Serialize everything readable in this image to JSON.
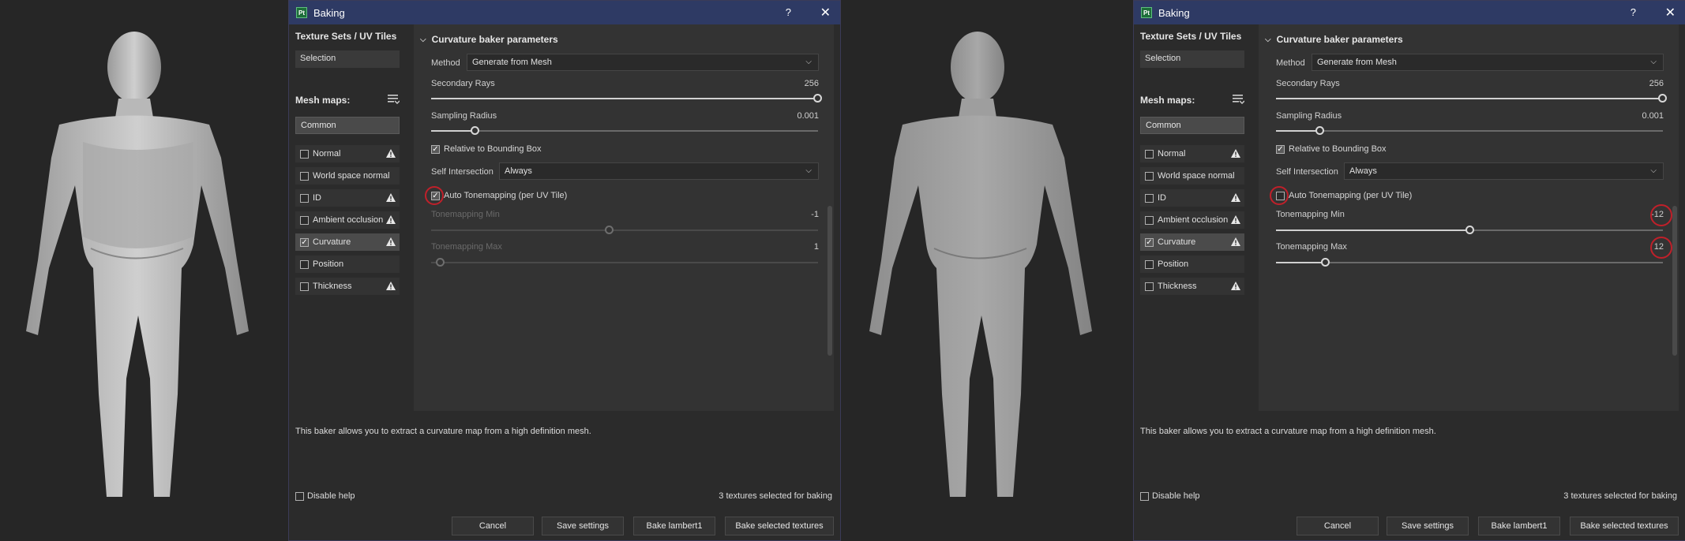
{
  "dialog": {
    "title": "Baking",
    "app_icon_label": "Pt",
    "help_button": "?",
    "close_button": "✕",
    "texture_sets_header": "Texture Sets / UV Tiles",
    "selection_label": "Selection",
    "mesh_maps_label": "Mesh maps:",
    "common_label": "Common",
    "mesh_maps": [
      {
        "label": "Normal",
        "checked": false,
        "warning": true
      },
      {
        "label": "World space normal",
        "checked": false,
        "warning": false
      },
      {
        "label": "ID",
        "checked": false,
        "warning": true
      },
      {
        "label": "Ambient occlusion",
        "checked": false,
        "warning": true
      },
      {
        "label": "Curvature",
        "checked": true,
        "warning": true
      },
      {
        "label": "Position",
        "checked": false,
        "warning": false
      },
      {
        "label": "Thickness",
        "checked": false,
        "warning": true
      }
    ],
    "section_title": "Curvature baker parameters",
    "method_label": "Method",
    "method_value": "Generate from Mesh",
    "secondary_rays_label": "Secondary Rays",
    "secondary_rays_value": "256",
    "sampling_radius_label": "Sampling Radius",
    "sampling_radius_value": "0.001",
    "relative_bbox_label": "Relative to Bounding Box",
    "self_intersection_label": "Self Intersection",
    "self_intersection_value": "Always",
    "auto_tonemapping_label": "Auto Tonemapping (per UV Tile)",
    "tonemapping_min_label": "Tonemapping Min",
    "tonemapping_max_label": "Tonemapping Max",
    "help_text": "This baker allows you to extract a curvature map from a high definition mesh.",
    "disable_help_label": "Disable help",
    "textures_selected": "3 textures selected for baking",
    "buttons": {
      "cancel": "Cancel",
      "save_settings": "Save settings",
      "bake_lambert": "Bake lambert1",
      "bake_selected": "Bake selected textures"
    }
  },
  "left_state": {
    "auto_tonemapping_checked": true,
    "tonemapping_min_value": "-1",
    "tonemapping_max_value": "1"
  },
  "right_state": {
    "auto_tonemapping_checked": false,
    "tonemapping_min_value": "-12",
    "tonemapping_max_value": "12"
  },
  "colors": {
    "titlebar": "#2e3a64",
    "highlight_circle": "#c0202a",
    "panel": "#333333",
    "background": "#262626"
  }
}
